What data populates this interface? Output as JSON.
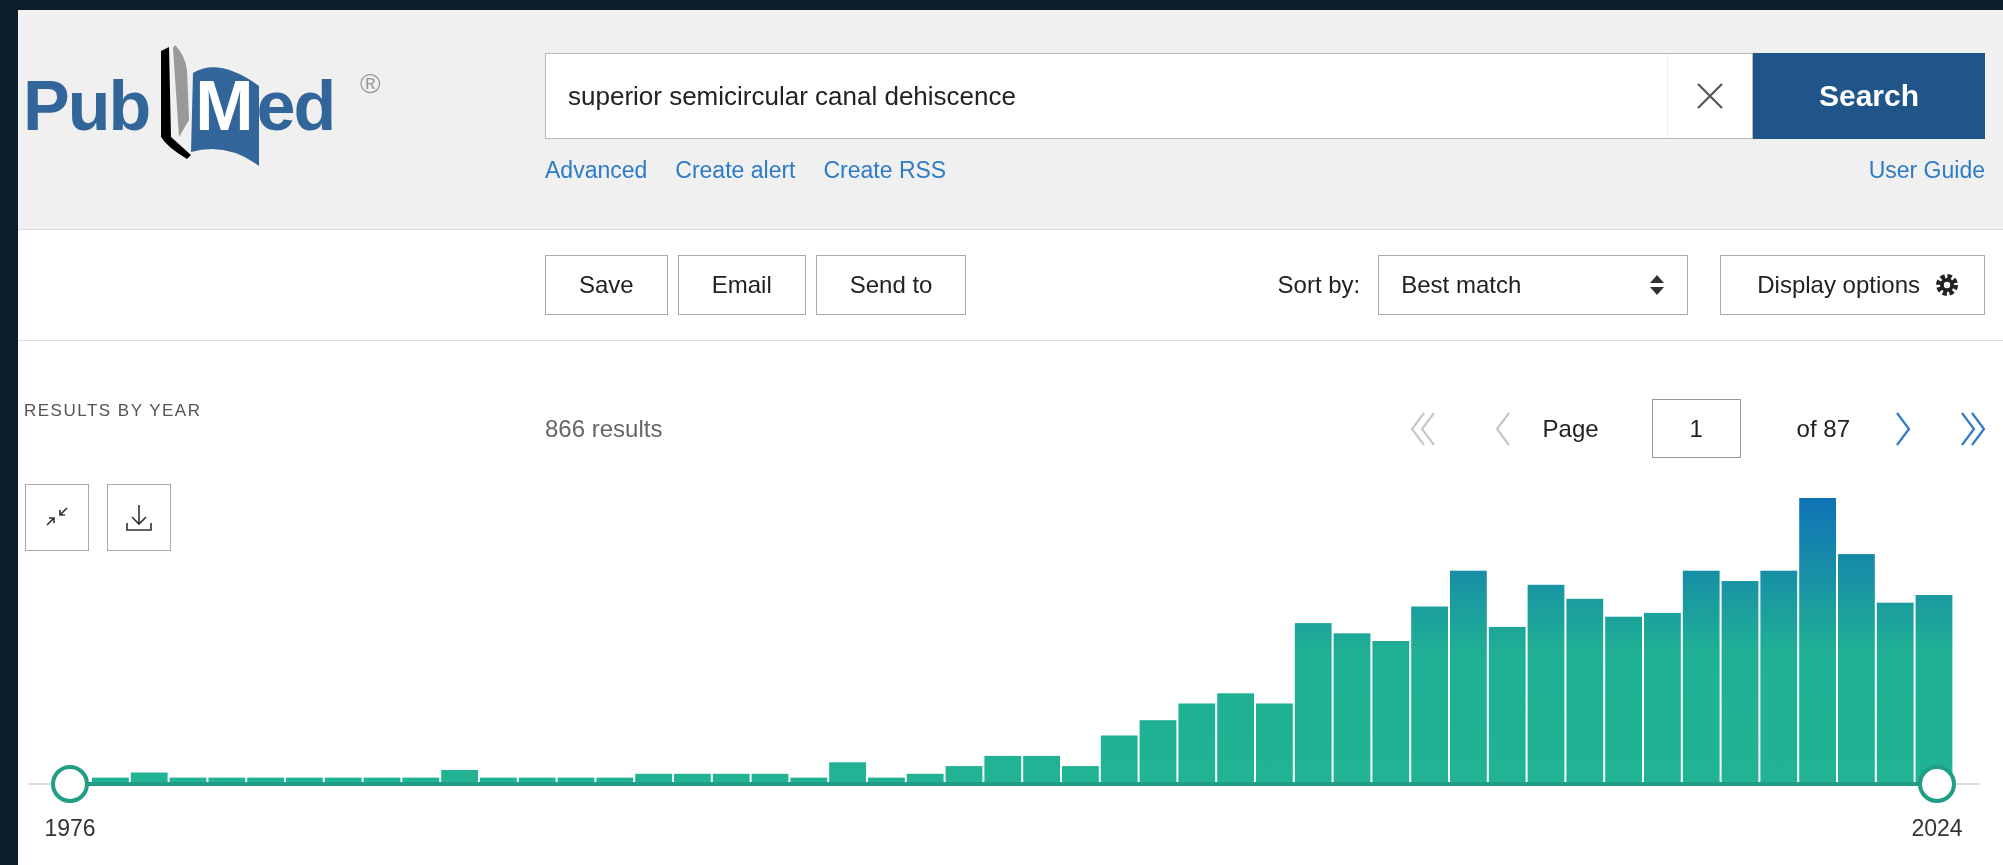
{
  "header": {
    "logo": {
      "left": "Pub",
      "emblem_letter": "M",
      "right": "ed",
      "mark": "®"
    },
    "search": {
      "value": "superior semicircular canal dehiscence",
      "button": "Search"
    },
    "links": [
      "Advanced",
      "Create alert",
      "Create RSS"
    ],
    "guide_link": "User Guide"
  },
  "toolbar": {
    "actions": [
      "Save",
      "Email",
      "Send to"
    ],
    "sort_label": "Sort by:",
    "sort_value": "Best match",
    "display_options": "Display options"
  },
  "timeline": {
    "title": "RESULTS BY YEAR",
    "start": {
      "label": "1976",
      "level": 0
    },
    "end": {
      "label": "2024",
      "level": 1
    }
  },
  "results": {
    "count": "866 results",
    "pagination": {
      "page_label": "Page",
      "page": "1",
      "of": "of 87",
      "first_disabled": true,
      "prev_disabled": true,
      "next_disabled": false,
      "last_disabled": false
    }
  }
}
